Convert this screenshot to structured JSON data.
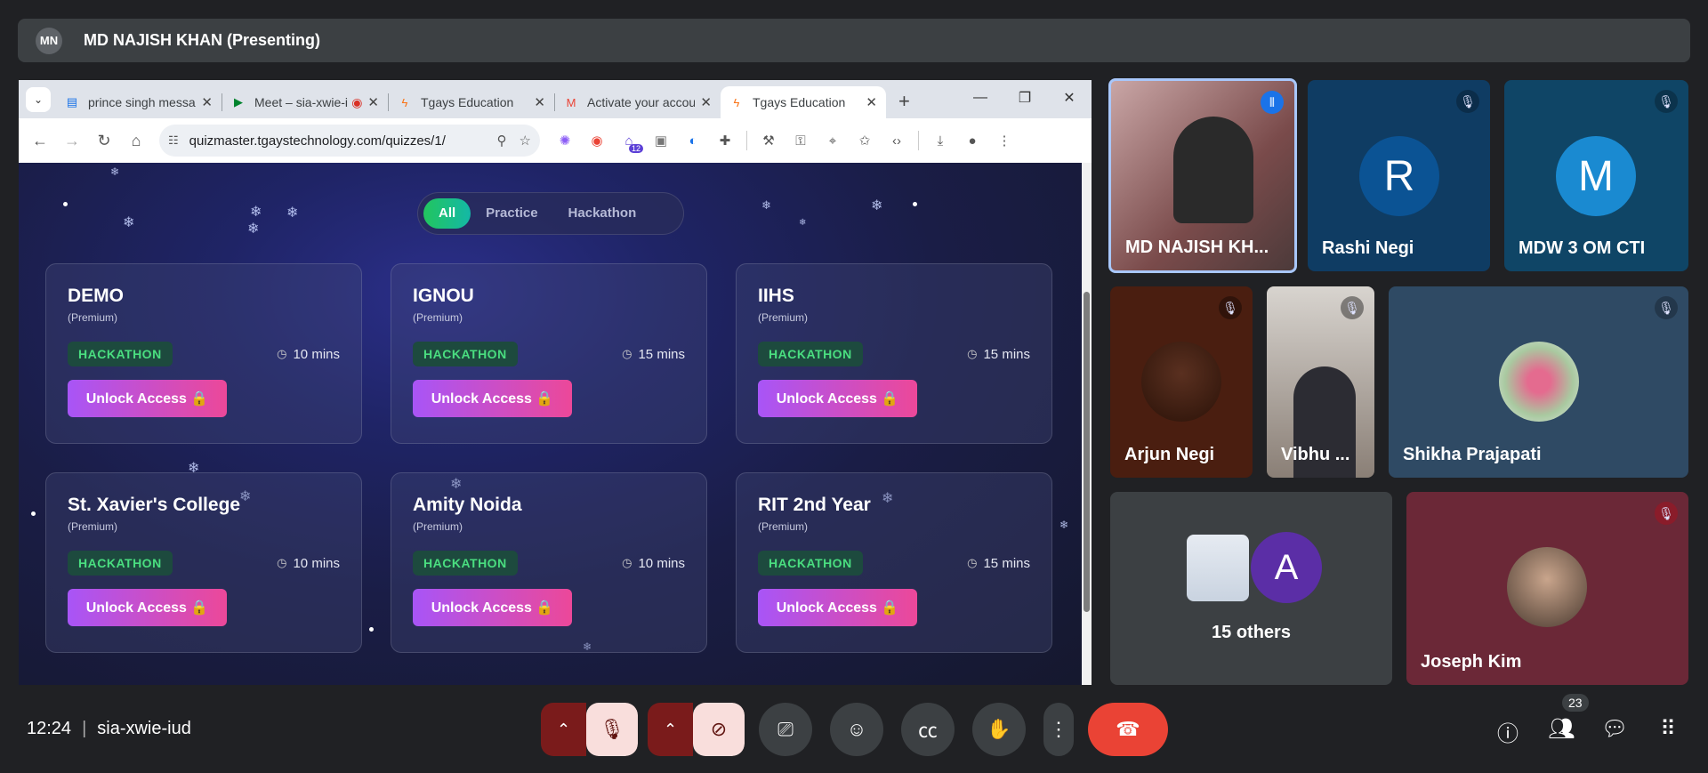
{
  "presenter": {
    "avatar_initials": "MN",
    "label": "MD NAJISH KHAN (Presenting)"
  },
  "browser": {
    "tabs": [
      {
        "title": "prince singh message",
        "icon": "list-icon",
        "active": false
      },
      {
        "title": "Meet – sia-xwie-iud",
        "icon": "meet-icon",
        "active": false
      },
      {
        "title": "Tgays Education",
        "icon": "bolt-icon",
        "active": false
      },
      {
        "title": "Activate your account",
        "icon": "gmail-icon",
        "active": false
      },
      {
        "title": "Tgays Education",
        "icon": "bolt-icon",
        "active": true
      }
    ],
    "url": "quizmaster.tgaystechnology.com/quizzes/1/",
    "extensions_badge": "12"
  },
  "quiz_page": {
    "filters": [
      "All",
      "Practice",
      "Hackathon"
    ],
    "active_filter": "All",
    "cards": [
      {
        "title": "DEMO",
        "sub": "(Premium)",
        "tag": "HACKATHON",
        "duration": "10 mins",
        "button": "Unlock Access 🔒"
      },
      {
        "title": "IGNOU",
        "sub": "(Premium)",
        "tag": "HACKATHON",
        "duration": "15 mins",
        "button": "Unlock Access 🔒"
      },
      {
        "title": "IIHS",
        "sub": "(Premium)",
        "tag": "HACKATHON",
        "duration": "15 mins",
        "button": "Unlock Access 🔒"
      },
      {
        "title": "St. Xavier's College",
        "sub": "(Premium)",
        "tag": "HACKATHON",
        "duration": "10 mins",
        "button": "Unlock Access 🔒"
      },
      {
        "title": "Amity Noida",
        "sub": "(Premium)",
        "tag": "HACKATHON",
        "duration": "10 mins",
        "button": "Unlock Access 🔒"
      },
      {
        "title": "RIT 2nd Year",
        "sub": "(Premium)",
        "tag": "HACKATHON",
        "duration": "15 mins",
        "button": "Unlock Access 🔒"
      }
    ]
  },
  "participants": [
    {
      "name": "MD NAJISH KH...",
      "type": "video",
      "speaking": true
    },
    {
      "name": "Rashi Negi",
      "initial": "R",
      "muted": true
    },
    {
      "name": "MDW 3 OM CTI",
      "initial": "M",
      "muted": true
    },
    {
      "name": "Arjun Negi",
      "type": "avatar",
      "muted": true
    },
    {
      "name": "Vibhu ...",
      "type": "video",
      "muted": true
    },
    {
      "name": "Shikha Prajapati",
      "type": "avatar",
      "muted": true
    },
    {
      "name": "15 others",
      "initial": "A"
    },
    {
      "name": "Joseph Kim",
      "type": "avatar",
      "muted": true
    }
  ],
  "meeting": {
    "time": "12:24",
    "code": "sia-xwie-iud",
    "people_count": "23"
  },
  "colors": {
    "accent_green": "#22c55e",
    "unlock_start": "#a855f7",
    "unlock_end": "#ec4899",
    "end_call": "#ea4335"
  }
}
